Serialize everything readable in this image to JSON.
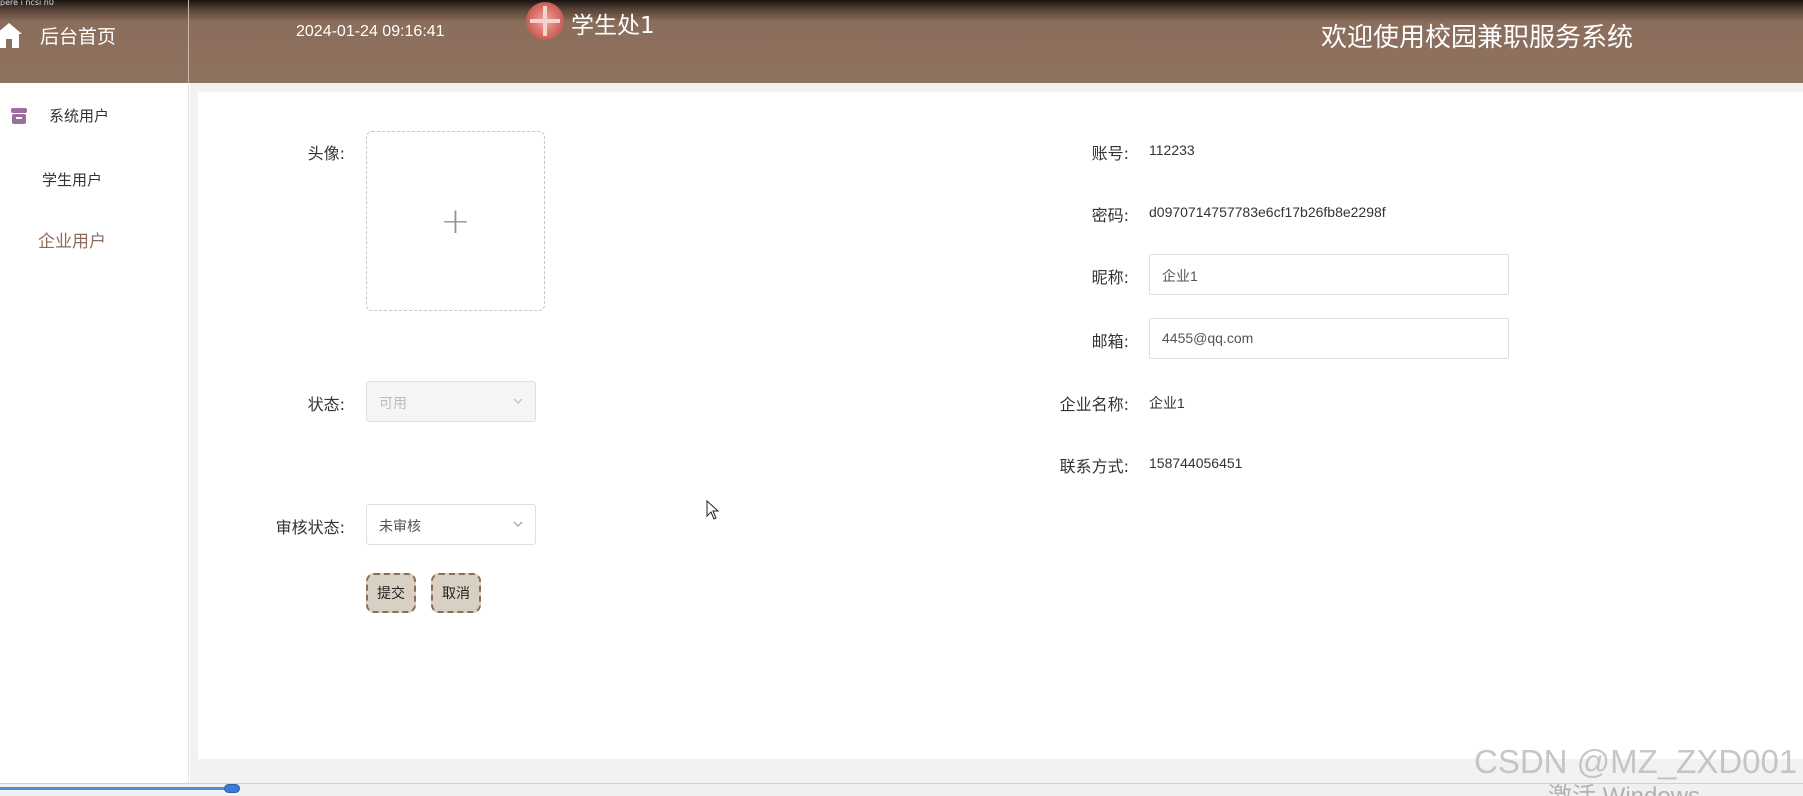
{
  "topbar": {
    "strip_text": "pere i ncsi n0"
  },
  "header": {
    "home_label": "后台首页",
    "datetime": "2024-01-24 09:16:41",
    "username": "学生处1",
    "welcome": "欢迎使用校园兼职服务系统"
  },
  "sidebar": {
    "group_label": "系统用户",
    "items": [
      {
        "label": "学生用户"
      },
      {
        "label": "企业用户"
      }
    ]
  },
  "form": {
    "avatar_label": "头像:",
    "status_label": "状态:",
    "status_value": "可用",
    "audit_label": "审核状态:",
    "audit_value": "未审核",
    "account_label": "账号:",
    "account_value": "112233",
    "password_label": "密码:",
    "password_value": "d0970714757783e6cf17b26fb8e2298f",
    "nickname_label": "昵称:",
    "nickname_value": "企业1",
    "email_label": "邮箱:",
    "email_value": "4455@qq.com",
    "company_label": "企业名称:",
    "company_value": "企业1",
    "contact_label": "联系方式:",
    "contact_value": "158744056451",
    "submit_label": "提交",
    "cancel_label": "取消"
  },
  "overlay": {
    "watermark": "CSDN @MZ_ZXD001",
    "activate": "激活 Windows"
  },
  "colors": {
    "header_brown": "#8f7260",
    "accent": "#8b6d5c",
    "button_bg": "#d9d0c4"
  }
}
